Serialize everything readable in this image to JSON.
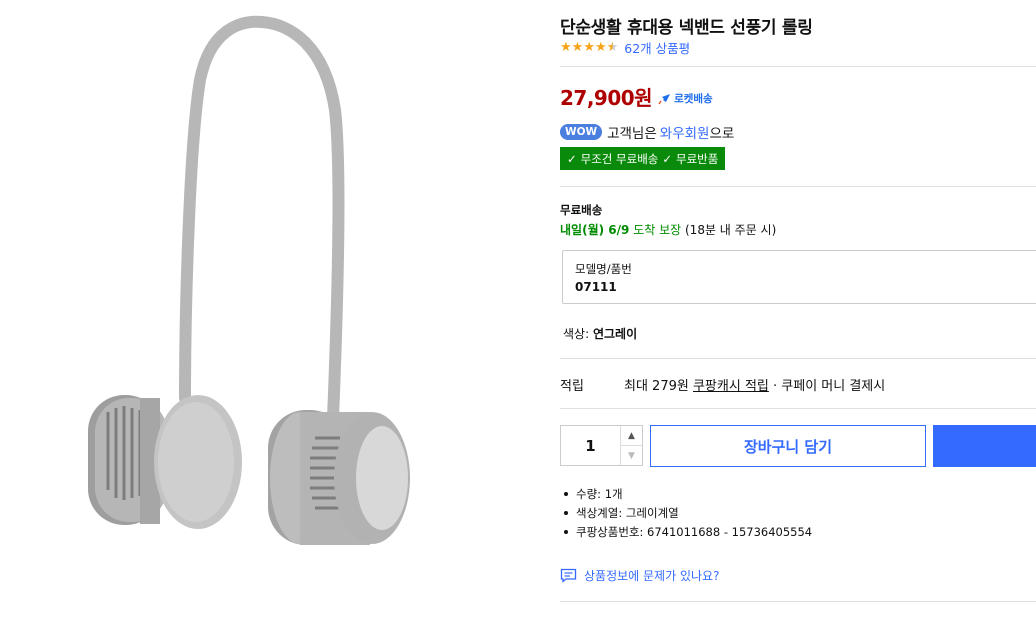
{
  "product": {
    "title": "단순생활 휴대용 넥밴드 선풍기 롤링",
    "rating": 4.5,
    "review_count": "62개 상품평",
    "price": "27,900원",
    "rocket_label": "로켓배송",
    "image_icon": "neckband-fan-image"
  },
  "membership": {
    "badge": "WOW",
    "text_before": "고객님은",
    "link": "와우회원",
    "text_after": "으로",
    "benefits": [
      "무조건 무료배송",
      "무료반품"
    ]
  },
  "shipping": {
    "label": "무료배송",
    "arrival_day": "내일(월) 6/9",
    "guarantee": "도착 보장",
    "note": "(18분 내 주문 시)"
  },
  "option": {
    "label": "모델명/품번",
    "value": "07111"
  },
  "color": {
    "label": "색상:",
    "value": "연그레이"
  },
  "points": {
    "label": "적립",
    "prefix": "최대 279원",
    "link": "쿠팡캐시 적립",
    "suffix": "· 쿠페이 머니 결제시"
  },
  "purchase": {
    "quantity": "1",
    "cart_label": "장바구니 담기",
    "buy_label": ""
  },
  "details": [
    "수량: 1개",
    "색상계열: 그레이계열",
    "쿠팡상품번호: 6741011688 - 15736405554"
  ],
  "report_link": "상품정보에 문제가 있나요?",
  "colors": {
    "price": "#ae0000",
    "link": "#346aff",
    "free_badge": "#0a8a0a",
    "star": "#f6a317"
  }
}
